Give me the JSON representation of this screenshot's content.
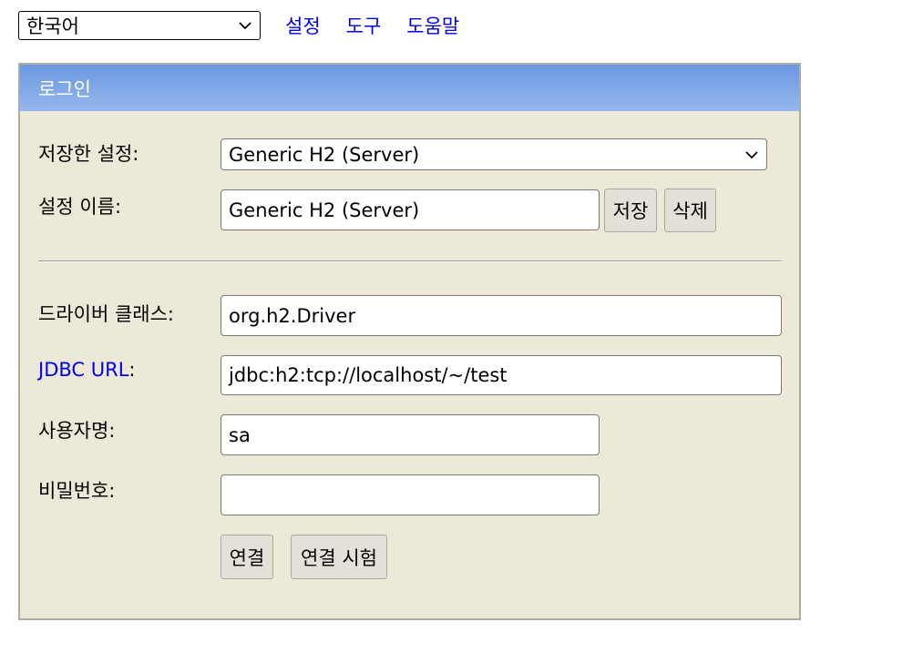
{
  "top": {
    "language": "한국어",
    "links": [
      "설정",
      "도구",
      "도움말"
    ]
  },
  "login": {
    "header": "로그인",
    "saved_settings_label": "저장한 설정:",
    "saved_settings_value": "Generic H2 (Server)",
    "setting_name_label": "설정 이름:",
    "setting_name_value": "Generic H2 (Server)",
    "save_button": "저장",
    "delete_button": "삭제",
    "driver_class_label": "드라이버 클래스:",
    "driver_class_value": "org.h2.Driver",
    "jdbc_url_link": "JDBC URL",
    "jdbc_url_colon": ":",
    "jdbc_url_value": "jdbc:h2:tcp://localhost/~/test",
    "username_label": "사용자명:",
    "username_value": "sa",
    "password_label": "비밀번호:",
    "password_value": "",
    "connect_button": "연결",
    "test_connection_button": "연결 시험"
  },
  "icons": {
    "dropdown": "chevron-down-icon"
  },
  "colors": {
    "header_gradient_top": "#6b98e2",
    "header_gradient_bottom": "#95b7ec",
    "panel_background": "#ece9d8",
    "link": "#0000ee"
  }
}
